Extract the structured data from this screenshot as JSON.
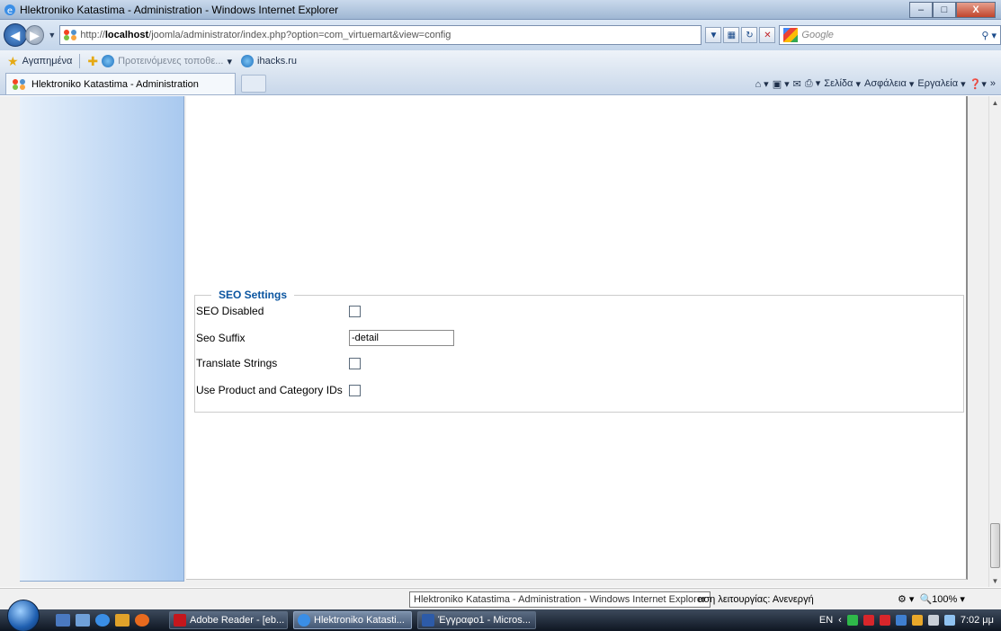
{
  "window": {
    "title": "Hlektroniko Katastima - Administration - Windows Internet Explorer",
    "min_label": "–",
    "max_label": "□",
    "close_label": "X"
  },
  "address": {
    "url_prefix": "http://",
    "url_host": "localhost",
    "url_path": "/joomla/administrator/index.php?option=com_virtuemart&view=config",
    "search_placeholder": "Google"
  },
  "favorites": {
    "label": "Αγαπημένα",
    "suggested": "Προτεινόμενες τοποθε...",
    "site": "ihacks.ru"
  },
  "tab": {
    "title": "Hlektroniko Katastima - Administration"
  },
  "commands": {
    "page": "Σελίδα",
    "safety": "Ασφάλεια",
    "tools": "Εργαλεία"
  },
  "seo": {
    "legend": "SEO Settings",
    "fields": [
      {
        "label": "SEO Disabled",
        "type": "checkbox",
        "checked": false
      },
      {
        "label": "Seo Suffix",
        "type": "text",
        "value": "-detail"
      },
      {
        "label": "Translate Strings",
        "type": "checkbox",
        "checked": false
      },
      {
        "label": "Use Product and Category IDs",
        "type": "checkbox",
        "checked": false
      }
    ]
  },
  "status": {
    "tooltip": "Hlektroniko Katastima - Administration - Windows Internet Explorer",
    "mode": "αση λειτουργίας: Ανενεργή",
    "zoom": "100%"
  },
  "taskbar": {
    "items": [
      {
        "label": "Adobe Reader - [eb..."
      },
      {
        "label": "Hlektroniko Katasti..."
      },
      {
        "label": "Έγγραφο1 - Micros..."
      }
    ],
    "lang": "EN",
    "time": "7:02 μμ"
  },
  "colors": {
    "legend": "#0b55a0",
    "left_panel": "#a9c9ef"
  }
}
